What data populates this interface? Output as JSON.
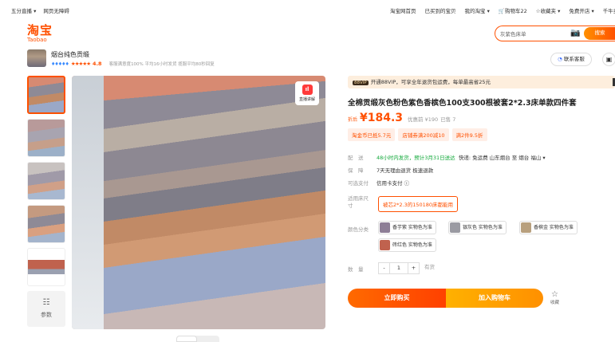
{
  "topbar": {
    "left": [
      "五分直播 ▾",
      "网页无障碍"
    ],
    "right": [
      "淘宝网首页",
      "已买到的宝贝",
      "我的淘宝 ▾",
      "购物车22",
      "☆收藏夹 ▾",
      "免费开店 ▾",
      "千牛卖家"
    ]
  },
  "logo": {
    "cn": "淘宝",
    "en": "Taobao"
  },
  "search": {
    "value": "灰紫色床单",
    "button": "搜索"
  },
  "shop": {
    "name": "烟台纯色贡缎",
    "score": "4.8",
    "meta": "客服满意度100% 平均16小时发货 揽服平均80秒回复"
  },
  "contact_label": "联系客服",
  "gallery": {
    "param_label": "参数",
    "live_label": "直播讲解"
  },
  "vip": {
    "tag": "88VIP",
    "text": "开通88VIP，可享全年退货包运费，每单最高省25元"
  },
  "product": {
    "title": "全棉贡缎灰色粉色紫色香槟色100支300根被套2*2.3床单款四件套",
    "price_label": "折后",
    "price": "¥184.3",
    "orig": "优惠前 ¥190",
    "sold": "已售 7",
    "coupons": [
      "淘金币已抵5.7元",
      "店铺券满200减10",
      "满2件9.5折"
    ]
  },
  "delivery": {
    "label": "配　送",
    "promise": "48小时内发货，预计3月31日送达",
    "detail": "快递: 免运费  山东烟台  至  烟台 福山 ▾"
  },
  "guarantee": {
    "label": "保　障",
    "value": "7天无理由退货  极速退款"
  },
  "payment": {
    "label": "可选支付",
    "value": "信用卡支付 ⓘ"
  },
  "size": {
    "label": "适用床尺寸",
    "value": "被芯2*2.3的150180床都能用"
  },
  "color": {
    "label": "颜色分类",
    "options": [
      {
        "label": "香芋紫 实物色为准",
        "swatch": "#8d7e96"
      },
      {
        "label": "银灰色 实物色为准",
        "swatch": "#9a9aa2"
      },
      {
        "label": "香槟金 实物色为准",
        "swatch": "#b8a07e"
      },
      {
        "label": "砖红色 实物色为准",
        "swatch": "#c0624e"
      }
    ]
  },
  "quantity": {
    "label": "数　量",
    "minus": "-",
    "value": "1",
    "plus": "+",
    "avail": "有货"
  },
  "actions": {
    "buy": "立即购买",
    "cart": "加入购物车",
    "fav": "收藏"
  },
  "colors": {
    "accent": "#ff5000",
    "green": "#11a839"
  }
}
